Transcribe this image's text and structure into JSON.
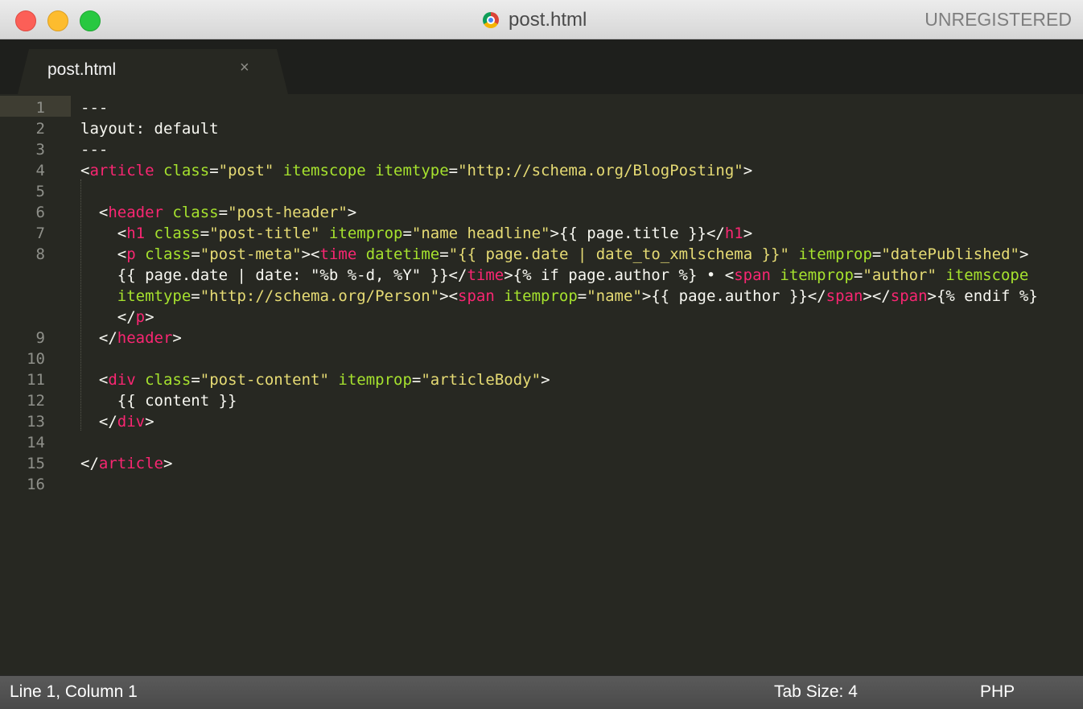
{
  "window": {
    "title": "post.html",
    "license": "UNREGISTERED"
  },
  "tabs": [
    {
      "label": "post.html",
      "close_glyph": "×"
    }
  ],
  "editor": {
    "line_numbers": [
      "1",
      "2",
      "3",
      "4",
      "5",
      "6",
      "7",
      "8",
      "9",
      "10",
      "11",
      "12",
      "13",
      "14",
      "15",
      "16"
    ],
    "lines": [
      {
        "ln": "1",
        "tokens": [
          {
            "t": "---",
            "c": "plain"
          }
        ]
      },
      {
        "ln": "2",
        "tokens": [
          {
            "t": "layout: default",
            "c": "plain"
          }
        ]
      },
      {
        "ln": "3",
        "tokens": [
          {
            "t": "---",
            "c": "plain"
          }
        ]
      },
      {
        "ln": "4",
        "tokens": [
          {
            "t": "<",
            "c": "plain"
          },
          {
            "t": "article",
            "c": "tag"
          },
          {
            "t": " ",
            "c": "plain"
          },
          {
            "t": "class",
            "c": "attr"
          },
          {
            "t": "=",
            "c": "plain"
          },
          {
            "t": "\"post\"",
            "c": "str"
          },
          {
            "t": " ",
            "c": "plain"
          },
          {
            "t": "itemscope",
            "c": "attr"
          },
          {
            "t": " ",
            "c": "plain"
          },
          {
            "t": "itemtype",
            "c": "attr"
          },
          {
            "t": "=",
            "c": "plain"
          },
          {
            "t": "\"http://schema.org/BlogPosting\"",
            "c": "str"
          },
          {
            "t": ">",
            "c": "plain"
          }
        ]
      },
      {
        "ln": "5",
        "tokens": []
      },
      {
        "ln": "6",
        "tokens": [
          {
            "t": "  <",
            "c": "plain"
          },
          {
            "t": "header",
            "c": "tag"
          },
          {
            "t": " ",
            "c": "plain"
          },
          {
            "t": "class",
            "c": "attr"
          },
          {
            "t": "=",
            "c": "plain"
          },
          {
            "t": "\"post-header\"",
            "c": "str"
          },
          {
            "t": ">",
            "c": "plain"
          }
        ]
      },
      {
        "ln": "7",
        "tokens": [
          {
            "t": "    <",
            "c": "plain"
          },
          {
            "t": "h1",
            "c": "tag"
          },
          {
            "t": " ",
            "c": "plain"
          },
          {
            "t": "class",
            "c": "attr"
          },
          {
            "t": "=",
            "c": "plain"
          },
          {
            "t": "\"post-title\"",
            "c": "str"
          },
          {
            "t": " ",
            "c": "plain"
          },
          {
            "t": "itemprop",
            "c": "attr"
          },
          {
            "t": "=",
            "c": "plain"
          },
          {
            "t": "\"name headline\"",
            "c": "str"
          },
          {
            "t": ">{{ page.title }}</",
            "c": "plain"
          },
          {
            "t": "h1",
            "c": "tag"
          },
          {
            "t": ">",
            "c": "plain"
          }
        ]
      },
      {
        "ln": "8",
        "tokens": [
          {
            "t": "    <",
            "c": "plain"
          },
          {
            "t": "p",
            "c": "tag"
          },
          {
            "t": " ",
            "c": "plain"
          },
          {
            "t": "class",
            "c": "attr"
          },
          {
            "t": "=",
            "c": "plain"
          },
          {
            "t": "\"post-meta\"",
            "c": "str"
          },
          {
            "t": "><",
            "c": "plain"
          },
          {
            "t": "time",
            "c": "tag"
          },
          {
            "t": " ",
            "c": "plain"
          },
          {
            "t": "datetime",
            "c": "attr"
          },
          {
            "t": "=",
            "c": "plain"
          },
          {
            "t": "\"{{ page.date | date_to_xmlschema }}\"",
            "c": "str"
          },
          {
            "t": " ",
            "c": "plain"
          },
          {
            "t": "itemprop",
            "c": "attr"
          },
          {
            "t": "=",
            "c": "plain"
          },
          {
            "t": "\"datePublished\"",
            "c": "str"
          },
          {
            "t": ">",
            "c": "plain"
          }
        ]
      },
      {
        "ln": "",
        "tokens": [
          {
            "t": "    {{ page.date | date: \"%b %-d, %Y\" }}</",
            "c": "plain"
          },
          {
            "t": "time",
            "c": "tag"
          },
          {
            "t": ">{% if page.author %} • <",
            "c": "plain"
          },
          {
            "t": "span",
            "c": "tag"
          },
          {
            "t": " ",
            "c": "plain"
          },
          {
            "t": "itemprop",
            "c": "attr"
          },
          {
            "t": "=",
            "c": "plain"
          },
          {
            "t": "\"author\"",
            "c": "str"
          },
          {
            "t": " ",
            "c": "plain"
          },
          {
            "t": "itemscope",
            "c": "attr"
          }
        ]
      },
      {
        "ln": "",
        "tokens": [
          {
            "t": "    ",
            "c": "plain"
          },
          {
            "t": "itemtype",
            "c": "attr"
          },
          {
            "t": "=",
            "c": "plain"
          },
          {
            "t": "\"http://schema.org/Person\"",
            "c": "str"
          },
          {
            "t": "><",
            "c": "plain"
          },
          {
            "t": "span",
            "c": "tag"
          },
          {
            "t": " ",
            "c": "plain"
          },
          {
            "t": "itemprop",
            "c": "attr"
          },
          {
            "t": "=",
            "c": "plain"
          },
          {
            "t": "\"name\"",
            "c": "str"
          },
          {
            "t": ">{{ page.author }}</",
            "c": "plain"
          },
          {
            "t": "span",
            "c": "tag"
          },
          {
            "t": "></",
            "c": "plain"
          },
          {
            "t": "span",
            "c": "tag"
          },
          {
            "t": ">{% endif %}",
            "c": "plain"
          }
        ]
      },
      {
        "ln": "",
        "tokens": [
          {
            "t": "    </",
            "c": "plain"
          },
          {
            "t": "p",
            "c": "tag"
          },
          {
            "t": ">",
            "c": "plain"
          }
        ]
      },
      {
        "ln": "9",
        "tokens": [
          {
            "t": "  </",
            "c": "plain"
          },
          {
            "t": "header",
            "c": "tag"
          },
          {
            "t": ">",
            "c": "plain"
          }
        ]
      },
      {
        "ln": "10",
        "tokens": []
      },
      {
        "ln": "11",
        "tokens": [
          {
            "t": "  <",
            "c": "plain"
          },
          {
            "t": "div",
            "c": "tag"
          },
          {
            "t": " ",
            "c": "plain"
          },
          {
            "t": "class",
            "c": "attr"
          },
          {
            "t": "=",
            "c": "plain"
          },
          {
            "t": "\"post-content\"",
            "c": "str"
          },
          {
            "t": " ",
            "c": "plain"
          },
          {
            "t": "itemprop",
            "c": "attr"
          },
          {
            "t": "=",
            "c": "plain"
          },
          {
            "t": "\"articleBody\"",
            "c": "str"
          },
          {
            "t": ">",
            "c": "plain"
          }
        ]
      },
      {
        "ln": "12",
        "tokens": [
          {
            "t": "    {{ content }}",
            "c": "plain"
          }
        ]
      },
      {
        "ln": "13",
        "tokens": [
          {
            "t": "  </",
            "c": "plain"
          },
          {
            "t": "div",
            "c": "tag"
          },
          {
            "t": ">",
            "c": "plain"
          }
        ]
      },
      {
        "ln": "14",
        "tokens": []
      },
      {
        "ln": "15",
        "tokens": [
          {
            "t": "</",
            "c": "plain"
          },
          {
            "t": "article",
            "c": "tag"
          },
          {
            "t": ">",
            "c": "plain"
          }
        ]
      },
      {
        "ln": "16",
        "tokens": []
      }
    ]
  },
  "status": {
    "position": "Line 1, Column 1",
    "tab_size": "Tab Size: 4",
    "syntax": "PHP"
  },
  "colors": {
    "tag": "#f92672",
    "attr": "#a6e22e",
    "string": "#e6db74",
    "text": "#f8f8f2",
    "background": "#272822"
  },
  "icons": {
    "tab_favicon": "chrome-icon"
  }
}
